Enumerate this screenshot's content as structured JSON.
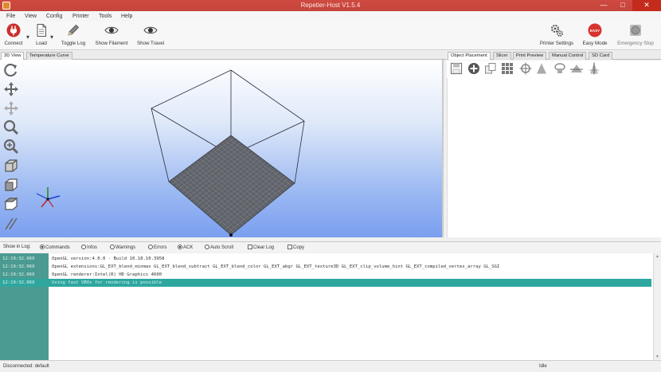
{
  "window": {
    "title": "Repetier-Host V1.5.4"
  },
  "menu": [
    "File",
    "View",
    "Config",
    "Printer",
    "Tools",
    "Help"
  ],
  "toolbar": {
    "connect": "Connect",
    "load": "Load",
    "toggle_log": "Toggle Log",
    "show_filament": "Show Filament",
    "show_travel": "Show Travel",
    "printer_settings": "Printer Settings",
    "easy_mode": "Easy Mode",
    "easy_badge": "EASY",
    "emergency_stop": "Emergency Stop"
  },
  "view_tabs": [
    "3D View",
    "Temperature Curve"
  ],
  "right_tabs": [
    "Object Placement",
    "Slicer",
    "Print Preview",
    "Manual Control",
    "SD Card"
  ],
  "log_bar": {
    "show_in_log": "Show in Log:",
    "commands": "Commands",
    "infos": "Infos",
    "warnings": "Warnings",
    "errors": "Errors",
    "ack": "ACK",
    "auto_scroll": "Auto Scroll",
    "clear_log": "Clear Log",
    "copy": "Copy"
  },
  "log": [
    {
      "time": "12:19:32.969",
      "text": "OpenGL version:4.0.0 - Build 10.18.10.3958"
    },
    {
      "time": "12:19:32.969",
      "text": "OpenGL extensions:GL_EXT_blend_minmax GL_EXT_blend_subtract GL_EXT_blend_color GL_EXT_abgr GL_EXT_texture3D GL_EXT_clip_volume_hint GL_EXT_compiled_vertex_array GL_SGI"
    },
    {
      "time": "12:19:32.969",
      "text": "OpenGL renderer:Intel(R) HD Graphics 4600"
    },
    {
      "time": "12:19:32.969",
      "text": "Using fast VBOs for rendering is possible"
    }
  ],
  "status": {
    "connection": "Disconnected: default",
    "state": "Idle"
  },
  "colors": {
    "titlebar": "#c8463c",
    "log_time": "#4b9b92",
    "log_highlight": "#2ea79f",
    "bed": "#5f6268"
  }
}
